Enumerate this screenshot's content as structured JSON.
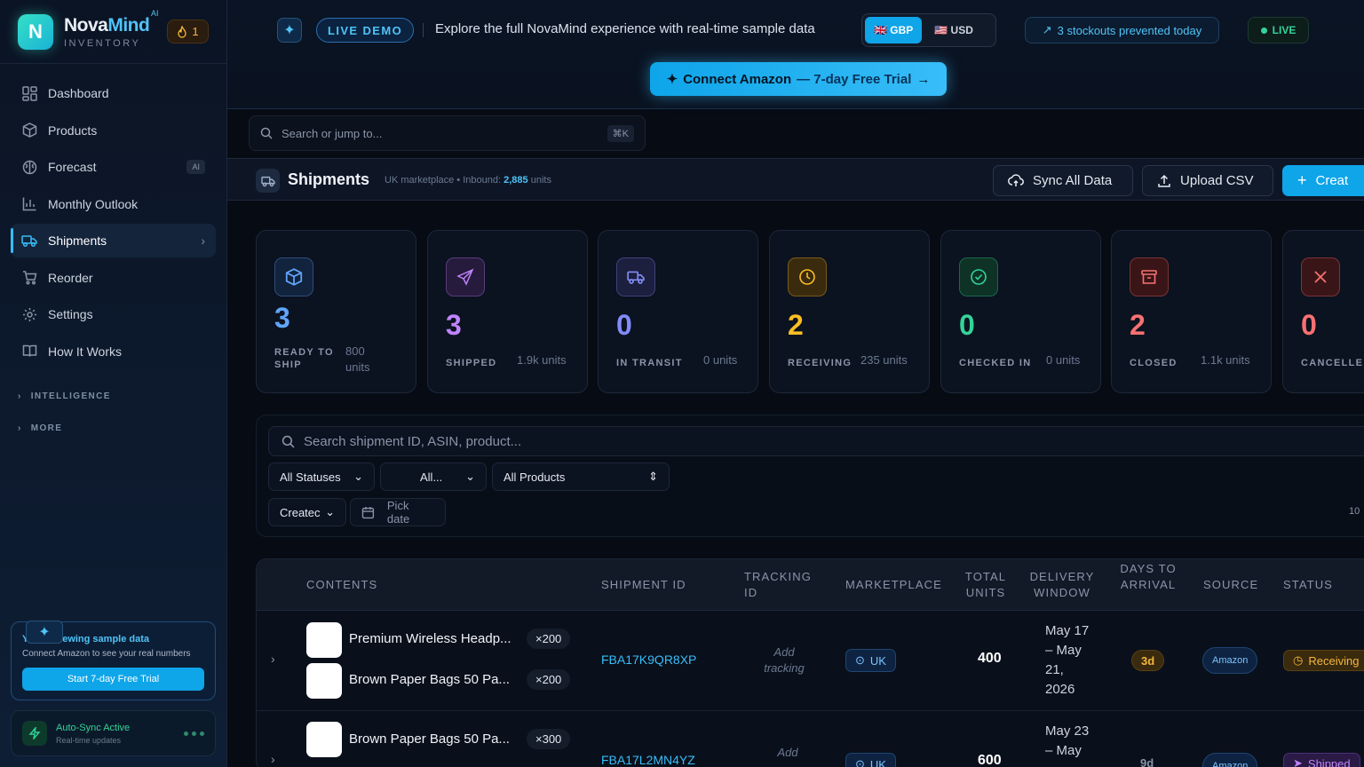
{
  "brand": {
    "name_a": "Nova",
    "name_b": "Mind",
    "sup": "AI",
    "sub": "INVENTORY",
    "logo": "N",
    "streak": "1"
  },
  "nav": [
    {
      "label": "Dashboard",
      "icon": "dashboard-icon"
    },
    {
      "label": "Products",
      "icon": "box-icon"
    },
    {
      "label": "Forecast",
      "icon": "brain-icon",
      "badge": "AI"
    },
    {
      "label": "Monthly Outlook",
      "icon": "bar-chart-icon"
    },
    {
      "label": "Shipments",
      "icon": "truck-icon",
      "active": true
    },
    {
      "label": "Reorder",
      "icon": "cart-icon"
    },
    {
      "label": "Settings",
      "icon": "gear-icon"
    },
    {
      "label": "How It Works",
      "icon": "book-icon"
    }
  ],
  "sections": {
    "intelligence": "INTELLIGENCE",
    "more": "MORE"
  },
  "promo": {
    "title": "You're viewing sample data",
    "text": "Connect Amazon to see your real numbers",
    "button": "Start 7-day Free Trial"
  },
  "sync": {
    "title": "Auto-Sync Active",
    "subtitle": "Real-time updates"
  },
  "demo": {
    "badge": "LIVE DEMO",
    "text": "Explore the full NovaMind experience with real-time sample data",
    "currency_gbp": "🇬🇧 GBP",
    "currency_usd": "🇺🇸 USD",
    "stockouts": "3 stockouts prevented today",
    "live": "LIVE",
    "connect": "Connect Amazon",
    "connect_trial": "— 7-day Free Trial"
  },
  "search": {
    "placeholder": "Search or jump to...",
    "shortcut": "⌘K"
  },
  "page": {
    "title": "Shipments",
    "subtitle_pre": "UK marketplace • Inbound:",
    "inbound": "2,885",
    "subtitle_post": "units",
    "sync_btn": "Sync All Data",
    "upload_btn": "Upload CSV",
    "create_btn": "Creat"
  },
  "cards": [
    {
      "num": "3",
      "label": "READY TO SHIP",
      "units": "800 units",
      "color": "#60a5fa",
      "bg": "#12233d",
      "icon": "box-icon"
    },
    {
      "num": "3",
      "label": "SHIPPED",
      "units": "1.9k units",
      "color": "#c084fc",
      "bg": "#261a3d",
      "icon": "send-icon"
    },
    {
      "num": "0",
      "label": "IN TRANSIT",
      "units": "0 units",
      "color": "#818cf8",
      "bg": "#1c1f3d",
      "icon": "truck-icon"
    },
    {
      "num": "2",
      "label": "RECEIVING",
      "units": "235 units",
      "color": "#fbbf24",
      "bg": "#3a2a0e",
      "icon": "clock-icon"
    },
    {
      "num": "0",
      "label": "CHECKED IN",
      "units": "0 units",
      "color": "#34d399",
      "bg": "#0e3326",
      "icon": "check-circle-icon"
    },
    {
      "num": "2",
      "label": "CLOSED",
      "units": "1.1k units",
      "color": "#f87171",
      "bg": "#3a1518",
      "icon": "archive-icon"
    },
    {
      "num": "0",
      "label": "CANCELLE",
      "units": "",
      "color": "#f87171",
      "bg": "#3a1518",
      "icon": "x-icon"
    }
  ],
  "filters": {
    "search_placeholder": "Search shipment ID, ASIN, product...",
    "statuses": "All Statuses",
    "all": "All...",
    "products": "All Products",
    "created": "Createc",
    "date": "Pick date",
    "pager": "10"
  },
  "table": {
    "headers": {
      "contents": "CONTENTS",
      "shipment_id": "SHIPMENT ID",
      "tracking": "TRACKING ID",
      "marketplace": "MARKETPLACE",
      "total": "TOTAL UNITS",
      "window": "DELIVERY WINDOW",
      "days": "DAYS TO ARRIVAL",
      "source": "SOURCE",
      "status": "STATUS"
    },
    "rows": [
      {
        "items": [
          {
            "name": "Premium Wireless Headp...",
            "qty": "×200"
          },
          {
            "name": "Brown Paper Bags 50 Pa...",
            "qty": "×200"
          }
        ],
        "id": "FBA17K9QR8XP",
        "tracking": "Add tracking",
        "market": "UK",
        "total": "400",
        "window": "May 17 – May 21, 2026",
        "days": "3d",
        "source": "Amazon",
        "status": "Receiving"
      },
      {
        "items": [
          {
            "name": "Brown Paper Bags 50 Pa...",
            "qty": "×300"
          }
        ],
        "id": "FBA17L2MN4YZ",
        "tracking": "Add",
        "market": "UK",
        "total": "600",
        "window": "May 23 – May",
        "days": "9d",
        "source": "Amazon",
        "status": "Shipped"
      }
    ]
  }
}
